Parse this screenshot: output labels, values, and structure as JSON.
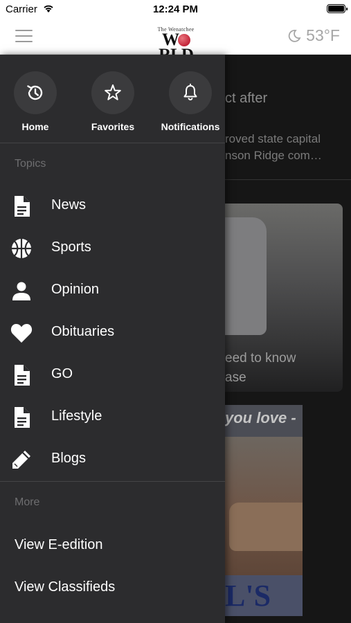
{
  "status_bar": {
    "carrier": "Carrier",
    "time": "12:24 PM"
  },
  "header": {
    "logo_top": "The Wenatchee",
    "logo_main_left": "W",
    "logo_main_right": "RLD",
    "temperature": "53°F"
  },
  "drawer": {
    "quick_links": [
      {
        "label": "Home",
        "icon": "history-icon"
      },
      {
        "label": "Favorites",
        "icon": "star-icon"
      },
      {
        "label": "Notifications",
        "icon": "bell-icon"
      }
    ],
    "topics_heading": "Topics",
    "topics": [
      {
        "label": "News",
        "icon": "document-icon"
      },
      {
        "label": "Sports",
        "icon": "basketball-icon"
      },
      {
        "label": "Opinion",
        "icon": "person-icon"
      },
      {
        "label": "Obituaries",
        "icon": "heart-icon"
      },
      {
        "label": "GO",
        "icon": "document-icon"
      },
      {
        "label": "Lifestyle",
        "icon": "document-icon"
      },
      {
        "label": "Blogs",
        "icon": "pencil-icon"
      }
    ],
    "more_heading": "More",
    "more_items": [
      {
        "label": "View E-edition"
      },
      {
        "label": "View Classifieds"
      }
    ]
  },
  "background": {
    "article_title_fragment": "ct after",
    "summary_line1": "roved state capital",
    "summary_line2": "nson Ridge com…",
    "card_caption_line1": "eed to know",
    "card_caption_line2": "ase",
    "ad_top_text": "you love -",
    "ad_bottom_text": "L'S"
  },
  "colors": {
    "drawer_bg": "#2c2c2e",
    "quick_circle": "#3b3b3d",
    "text_primary": "#ffffff",
    "text_muted": "#6e6e70",
    "logo_globe": "#c3263a"
  }
}
